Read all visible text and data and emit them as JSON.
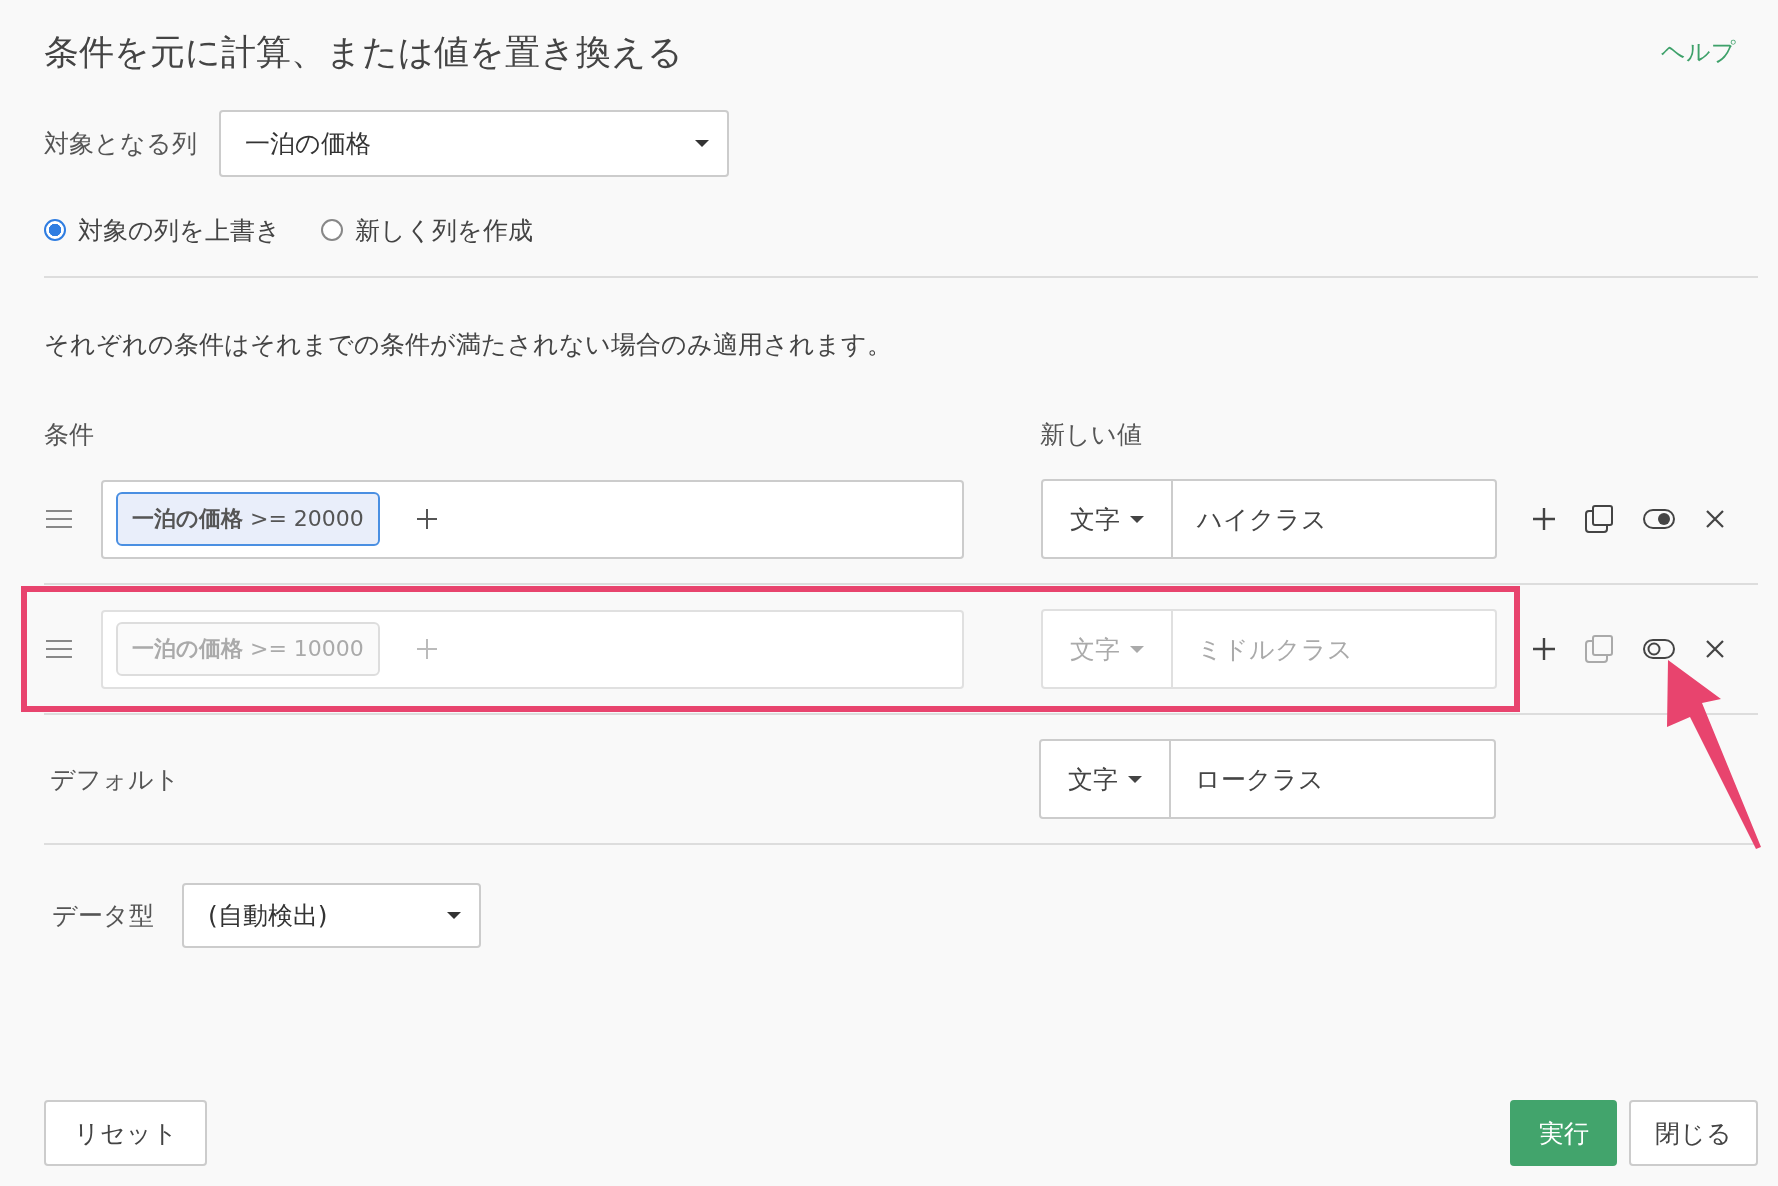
{
  "title": "条件を元に計算、または値を置き換える",
  "help_link": "ヘルプ",
  "target_column": {
    "label": "対象となる列",
    "value": "一泊の価格"
  },
  "output_mode": [
    {
      "label": "対象の列を上書き",
      "selected": true
    },
    {
      "label": "新しく列を作成",
      "selected": false
    }
  ],
  "note": "それぞれの条件はそれまでの条件が満たされない場合のみ適用されます。",
  "headers": {
    "condition": "条件",
    "new_value": "新しい値"
  },
  "rules": [
    {
      "enabled": true,
      "highlighted": false,
      "condition": "**一泊の価格** >= 20000",
      "value_type": "文字",
      "value": "ハイクラス"
    },
    {
      "enabled": false,
      "highlighted": true,
      "condition": "**一泊の価格** >= 10000",
      "value_type": "文字",
      "value": "ミドルクラス"
    }
  ],
  "pointer_arrow": true,
  "default": {
    "label": "デフォルト",
    "value_type": "文字",
    "value": "ロークラス"
  },
  "data_type": {
    "label": "データ型",
    "value": "(自動検出)"
  },
  "buttons": [
    {
      "label": "リセット",
      "kind": "secondary"
    },
    {
      "label": "実行",
      "kind": "primary"
    },
    {
      "label": "閉じる",
      "kind": "secondary"
    }
  ]
}
